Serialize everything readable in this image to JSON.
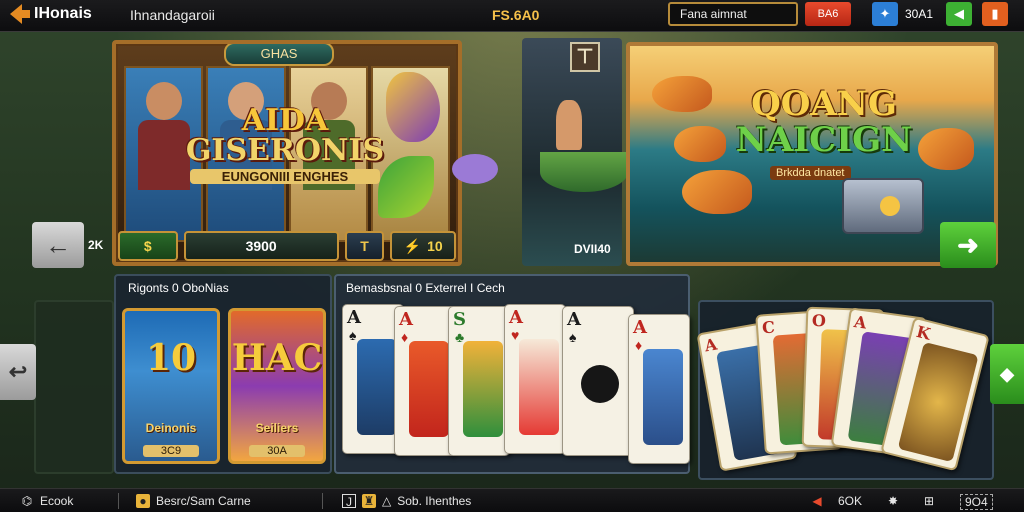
{
  "topbar": {
    "logo_text": "IHonais",
    "subtitle": "Ihnandagaroii",
    "balance": "FS.6A0",
    "search_placeholder": "Fana aimnat",
    "red_button_label": "BA6",
    "count": "30A1"
  },
  "slot": {
    "banner": "GHAS",
    "title_line1": "AIDA",
    "title_line2": "GISERONIS",
    "tagline": "EUNGONIII ENGHES",
    "controls": {
      "coin": "$",
      "bar_value": "3900",
      "small": "T",
      "win": "10"
    },
    "nav_left_value": "2K"
  },
  "boat": {
    "label": "DVII40"
  },
  "fishing": {
    "title_line1": "QOANG",
    "title_line2": "NAICIGN",
    "tag": "Brkdda dnatet"
  },
  "section_a": {
    "title": "Rigonts 0 OboNias",
    "cards": [
      {
        "big": "10",
        "name": "Deinonis",
        "value": "3C9"
      },
      {
        "big": "HAC",
        "name": "Seiliers",
        "value": "30A"
      }
    ]
  },
  "section_b": {
    "title": "Bemasbsnal 0 Exterrel I Cech",
    "cards": [
      {
        "rank": "A",
        "suit": "♠"
      },
      {
        "rank": "A",
        "suit": "♦"
      },
      {
        "rank": "S",
        "suit": "♣"
      },
      {
        "rank": "A",
        "suit": "♥"
      },
      {
        "rank": "A",
        "suit": "♠"
      },
      {
        "rank": "A",
        "suit": "♦"
      }
    ]
  },
  "section_c": {
    "cards": [
      {
        "rank": "A"
      },
      {
        "rank": "C"
      },
      {
        "rank": "O"
      },
      {
        "rank": "A"
      },
      {
        "rank": "K"
      }
    ]
  },
  "bottombar": {
    "item1": "Ecook",
    "item2": "Besrc/Sam Carne",
    "item3_num": "J",
    "item3": "Sob. Ihenthes",
    "item4": "6OK",
    "item5": "9O4"
  },
  "colors": {
    "accent_gold": "#d39a32",
    "accent_green": "#2a8d1c",
    "accent_red": "#e84a2d",
    "accent_blue": "#1e6bb5"
  }
}
